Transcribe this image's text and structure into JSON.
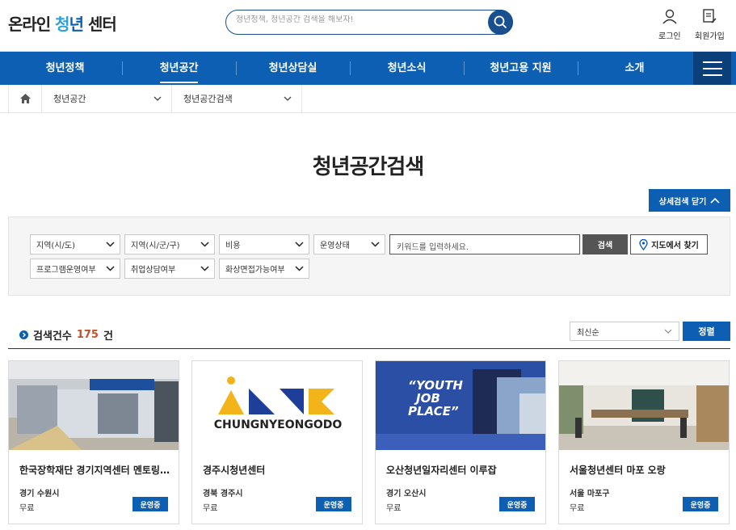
{
  "header": {
    "logo_parts": [
      "온라인 ",
      "청",
      "년",
      " 센터"
    ],
    "search_placeholder": "청년정책, 청년공간 검색을 해보자!",
    "login_label": "로그인",
    "signup_label": "회원가입"
  },
  "nav": {
    "items": [
      "청년정책",
      "청년공간",
      "청년상담실",
      "청년소식",
      "청년고용 지원",
      "소개"
    ],
    "active_index": 1
  },
  "breadcrumb": {
    "level1": "청년공간",
    "level2": "청년공간검색"
  },
  "page_title": "청년공간검색",
  "advanced_toggle_label": "상세검색 닫기",
  "filters": {
    "region_sido": "지역(시/도)",
    "region_sigungu": "지역(시/군/구)",
    "cost": "비용",
    "status": "운영상태",
    "keyword_placeholder": "키워드를 입력하세요.",
    "search_button": "검색",
    "map_button": "지도에서 찾기",
    "program": "프로그램운영여부",
    "counseling": "취업상담여부",
    "interview": "화상면접가능여부"
  },
  "results": {
    "count_label": "검색건수",
    "count": "175",
    "count_unit": "건",
    "sort_value": "최신순",
    "sort_button": "정렬"
  },
  "cards": [
    {
      "name": "한국장학재단 경기지역센터 멘토링 라운지",
      "location": "경기 수원시",
      "fee": "무료",
      "status": "운영중"
    },
    {
      "name": "경주시청년센터",
      "location": "경북 경주시",
      "fee": "무료",
      "status": "운영중",
      "logo_text": "CHUNGNYEONGODO"
    },
    {
      "name": "오산청년일자리센터 이루잡",
      "location": "경기 오산시",
      "fee": "무료",
      "status": "운영중",
      "wall_text": [
        "“YOUTH",
        "JOB",
        "PLACE”"
      ]
    },
    {
      "name": "서울청년센터 마포 오랑",
      "location": "서울 마포구",
      "fee": "무료",
      "status": "운영중"
    }
  ],
  "colors": {
    "primary": "#0d5fb3",
    "primary_dark": "#0b3f7a",
    "count_accent": "#c0522c"
  }
}
